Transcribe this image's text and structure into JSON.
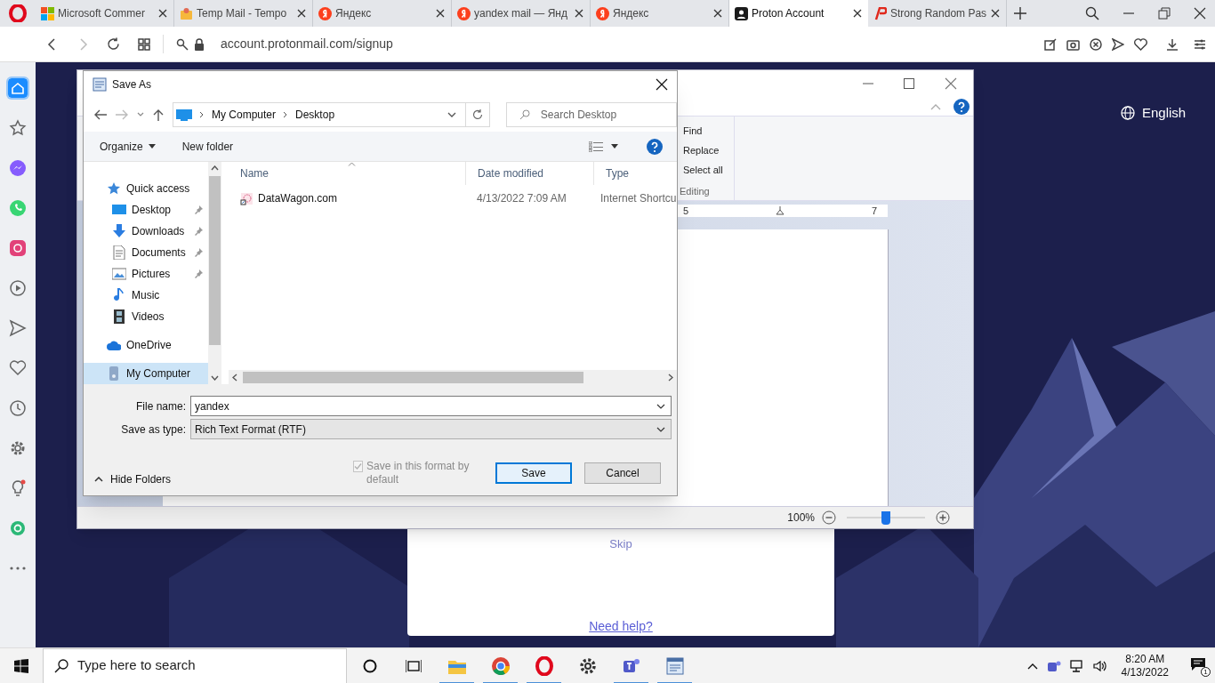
{
  "browser": {
    "tabs": [
      {
        "label": "Microsoft Commer",
        "kind": "microsoft",
        "selected": false
      },
      {
        "label": "Temp Mail - Tempo",
        "kind": "tempmail",
        "selected": false
      },
      {
        "label": "Яндекс",
        "kind": "yandex",
        "selected": false
      },
      {
        "label": "yandex mail — Янд",
        "kind": "yandex",
        "selected": false
      },
      {
        "label": "Яндекс",
        "kind": "yandex",
        "selected": false
      },
      {
        "label": "Proton Account",
        "kind": "proton",
        "selected": true
      },
      {
        "label": "Strong Random Pas",
        "kind": "password",
        "selected": false
      }
    ],
    "address": "account.protonmail.com/signup"
  },
  "sidebar": {
    "items": [
      {
        "kind": "home",
        "selected": true
      },
      {
        "kind": "star",
        "selected": false
      },
      {
        "kind": "messenger",
        "selected": false
      },
      {
        "kind": "whatsapp",
        "selected": false
      },
      {
        "kind": "instagram",
        "selected": false
      },
      {
        "kind": "player",
        "selected": false
      },
      {
        "kind": "send",
        "selected": false
      },
      {
        "kind": "heart",
        "selected": false
      },
      {
        "kind": "clock",
        "selected": false
      },
      {
        "kind": "settings",
        "selected": false
      },
      {
        "kind": "bulb",
        "selected": false
      },
      {
        "kind": "app",
        "selected": false
      },
      {
        "kind": "more",
        "selected": false
      }
    ]
  },
  "page": {
    "language": "English",
    "skip": "Skip",
    "help_link": "Need help?"
  },
  "wordpad": {
    "editing": {
      "items": [
        "Find",
        "Replace",
        "Select all"
      ],
      "group": "Editing"
    },
    "ruler_labels": [
      "5",
      "7"
    ],
    "zoom": {
      "reading": "100%",
      "level": 0.5
    }
  },
  "dialog": {
    "title": "Save As",
    "path": [
      "My Computer",
      "Desktop"
    ],
    "search_placeholder": "Search Desktop",
    "toolbar": {
      "organize": "Organize",
      "new_folder": "New folder"
    },
    "nav": [
      {
        "label": "Quick access",
        "kind": "star",
        "selected": false,
        "children": [
          {
            "label": "Desktop",
            "kind": "desktop",
            "pinned": true,
            "selected": false
          },
          {
            "label": "Downloads",
            "kind": "download",
            "pinned": true,
            "selected": false
          },
          {
            "label": "Documents",
            "kind": "document",
            "pinned": true,
            "selected": false
          },
          {
            "label": "Pictures",
            "kind": "pictures",
            "pinned": true,
            "selected": false
          },
          {
            "label": "Music",
            "kind": "music",
            "pinned": false,
            "selected": false
          },
          {
            "label": "Videos",
            "kind": "videos",
            "pinned": false,
            "selected": false
          }
        ]
      },
      {
        "label": "OneDrive",
        "kind": "cloud",
        "selected": false
      },
      {
        "label": "My Computer",
        "kind": "computer",
        "selected": true
      }
    ],
    "columns": [
      "Name",
      "Date modified",
      "Type"
    ],
    "rows": [
      {
        "name": "DataWagon.com",
        "date": "4/13/2022 7:09 AM",
        "type": "Internet Shortcu",
        "selected": false
      }
    ],
    "file_name_label": "File name:",
    "file_name": "yandex",
    "save_type_label": "Save as type:",
    "save_type": "Rich Text Format (RTF)",
    "save_default": {
      "label": "Save in this format by default",
      "checked": true,
      "disabled": true
    },
    "buttons": [
      {
        "label": "Save",
        "default": true
      },
      {
        "label": "Cancel",
        "default": false
      }
    ],
    "hide_folders": "Hide Folders"
  },
  "taskbar": {
    "search_placeholder": "Type here to search",
    "apps": [
      {
        "kind": "explorer",
        "running": true
      },
      {
        "kind": "chrome",
        "running": true
      },
      {
        "kind": "opera",
        "running": true
      },
      {
        "kind": "settings",
        "running": false
      },
      {
        "kind": "teams",
        "running": true
      },
      {
        "kind": "wordpad",
        "running": true
      }
    ],
    "time": "8:20 AM",
    "date": "4/13/2022",
    "notification_count": "1"
  }
}
